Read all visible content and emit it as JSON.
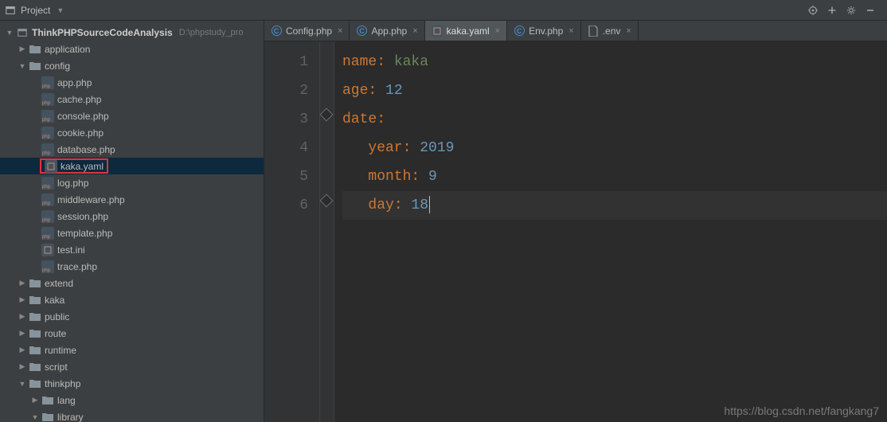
{
  "toolbar": {
    "project_label": "Project"
  },
  "tree": {
    "root": {
      "name": "ThinkPHPSourceCodeAnalysis",
      "path": "D:\\phpstudy_pro"
    },
    "folders": {
      "application": "application",
      "config": "config",
      "extend": "extend",
      "kaka": "kaka",
      "public": "public",
      "route": "route",
      "runtime": "runtime",
      "script": "script",
      "thinkphp": "thinkphp",
      "lang": "lang",
      "library": "library"
    },
    "config_files": {
      "app": "app.php",
      "cache": "cache.php",
      "console": "console.php",
      "cookie": "cookie.php",
      "database": "database.php",
      "kaka_yaml": "kaka.yaml",
      "log": "log.php",
      "middleware": "middleware.php",
      "session": "session.php",
      "template": "template.php",
      "test_ini": "test.ini",
      "trace": "trace.php"
    }
  },
  "tabs": {
    "config": "Config.php",
    "app": "App.php",
    "kaka": "kaka.yaml",
    "env_php": "Env.php",
    "env": ".env"
  },
  "code": {
    "l1_key": "name",
    "l1_val": "kaka",
    "l2_key": "age",
    "l2_val": "12",
    "l3_key": "date",
    "l3_ind": "  ",
    "l4_ind": "   ",
    "l4_key": "year",
    "l4_val": "2019",
    "l5_ind": "   ",
    "l5_key": "month",
    "l5_val": "9",
    "l6_ind": "   ",
    "l6_key": "day",
    "l6_val": "18"
  },
  "gutter": [
    "1",
    "2",
    "3",
    "4",
    "5",
    "6"
  ],
  "watermark": "https://blog.csdn.net/fangkang7"
}
